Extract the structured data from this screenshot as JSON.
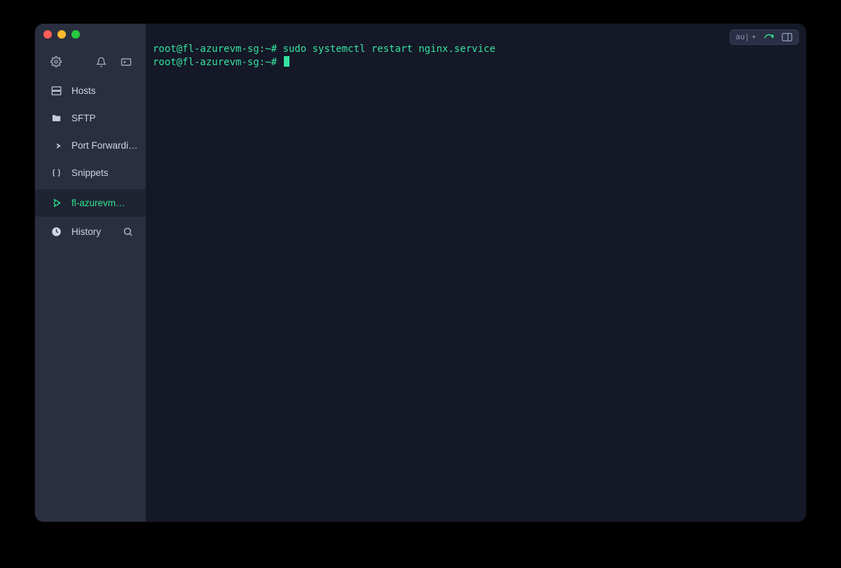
{
  "colors": {
    "accent": "#34e2a0",
    "sidebar_bg": "#2a2f40",
    "terminal_bg": "#151827"
  },
  "sidebar": {
    "items": [
      {
        "id": "hosts",
        "label": "Hosts",
        "icon": "server-icon"
      },
      {
        "id": "sftp",
        "label": "SFTP",
        "icon": "folder-icon"
      },
      {
        "id": "portfwd",
        "label": "Port Forwarding",
        "icon": "arrow-forward-icon"
      },
      {
        "id": "snippets",
        "label": "Snippets",
        "icon": "braces-icon"
      },
      {
        "id": "session",
        "label": "fl-azurevm…",
        "icon": "ubuntu-icon",
        "active": true
      }
    ],
    "history_label": "History"
  },
  "terminal": {
    "lines": [
      {
        "prompt": "root@fl-azurevm-sg:~# ",
        "command": "sudo systemctl restart nginx.service"
      },
      {
        "prompt": "root@fl-azurevm-sg:~# ",
        "command": "",
        "cursor": true
      }
    ]
  },
  "toolbar": {
    "chip_text": "au|",
    "chip_plus": "+"
  }
}
